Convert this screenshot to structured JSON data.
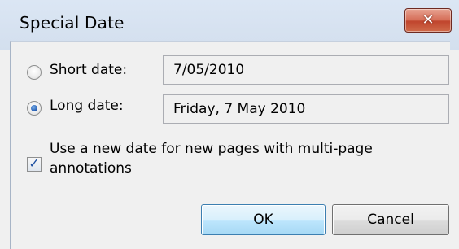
{
  "window": {
    "title": "Special Date",
    "close_glyph": "✕"
  },
  "options": {
    "short_date": {
      "label": "Short date:",
      "value": "7/05/2010",
      "selected": false
    },
    "long_date": {
      "label": "Long date:",
      "value": "Friday, 7 May 2010",
      "selected": true
    }
  },
  "multipage": {
    "label_line1": "Use a new date for new pages with multi-page",
    "label_line2": "annotations",
    "checked": true,
    "check_glyph": "✓"
  },
  "buttons": {
    "ok_label": "OK",
    "cancel_label": "Cancel"
  },
  "colors": {
    "titlebar": "#d3dfee",
    "close_button": "#c7503a",
    "selected_radio": "#2a63b8",
    "ok_button_accent": "#a7d9f5"
  }
}
